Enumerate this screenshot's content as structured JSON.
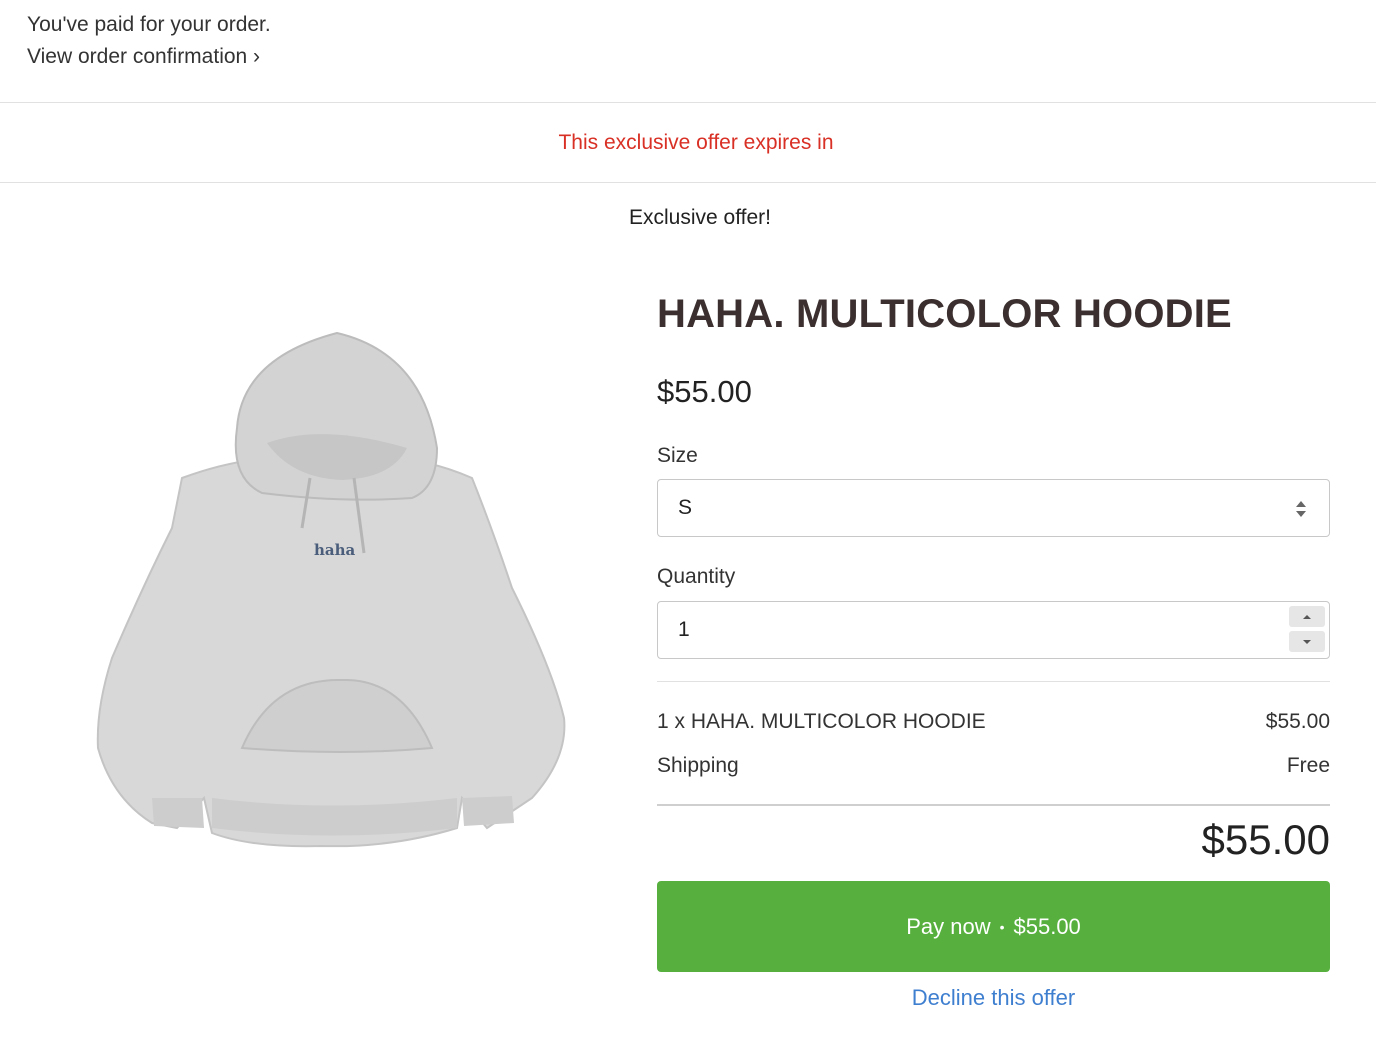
{
  "notice": {
    "paid_text": "You've paid for your order.",
    "confirmation_link": "View order confirmation ›"
  },
  "banner": {
    "expire_text": "This exclusive offer expires in"
  },
  "offer": {
    "heading": "Exclusive offer!"
  },
  "product": {
    "title": "HAHA. MULTICOLOR HOODIE",
    "price": "$55.00",
    "image_text": "haha"
  },
  "form": {
    "size_label": "Size",
    "size_value": "S",
    "quantity_label": "Quantity",
    "quantity_value": "1"
  },
  "summary": {
    "line_item_label": "1 x HAHA. MULTICOLOR HOODIE",
    "line_item_price": "$55.00",
    "shipping_label": "Shipping",
    "shipping_value": "Free",
    "total": "$55.00"
  },
  "actions": {
    "pay_label": "Pay now",
    "pay_separator": "•",
    "pay_amount": "$55.00",
    "decline_label": "Decline this offer"
  },
  "colors": {
    "accent_green": "#57b03e",
    "link_blue": "#3f7fd0",
    "warning_red": "#d93025"
  }
}
